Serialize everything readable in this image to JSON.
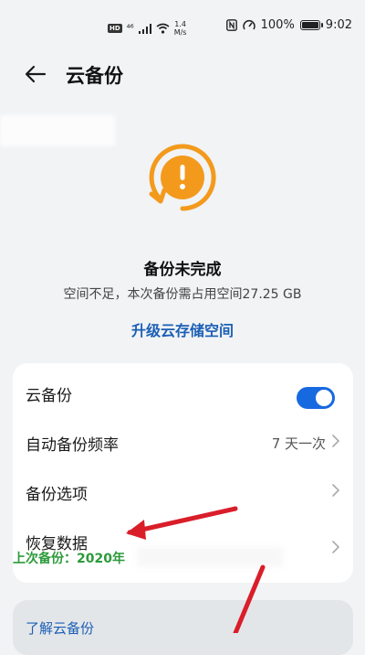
{
  "status_bar": {
    "hd_badge": "HD",
    "network": "⁴⁶",
    "speed_value": "1.4",
    "speed_unit": "M/s",
    "battery_percent": "100%",
    "battery_level": 1.0,
    "time": "9:02"
  },
  "header": {
    "title": "云备份"
  },
  "backup_status": {
    "icon": "warning-refresh-icon",
    "title": "备份未完成",
    "subtitle": "空间不足，本次备份需占用空间27.25 GB",
    "upgrade_label": "升级云存储空间"
  },
  "settings": {
    "cloud_backup_label": "云备份",
    "cloud_backup_enabled": true,
    "frequency_label": "自动备份频率",
    "frequency_value": "7 天一次",
    "options_label": "备份选项",
    "restore_label": "恢复数据",
    "last_backup_text": "上次备份：2020年"
  },
  "learn_more": {
    "label": "了解云备份"
  },
  "colors": {
    "accent": "#1769e0",
    "link": "#1b5fb5",
    "warning": "#f39a1c",
    "success": "#2c9a3a",
    "annotation": "#d91e2a"
  }
}
